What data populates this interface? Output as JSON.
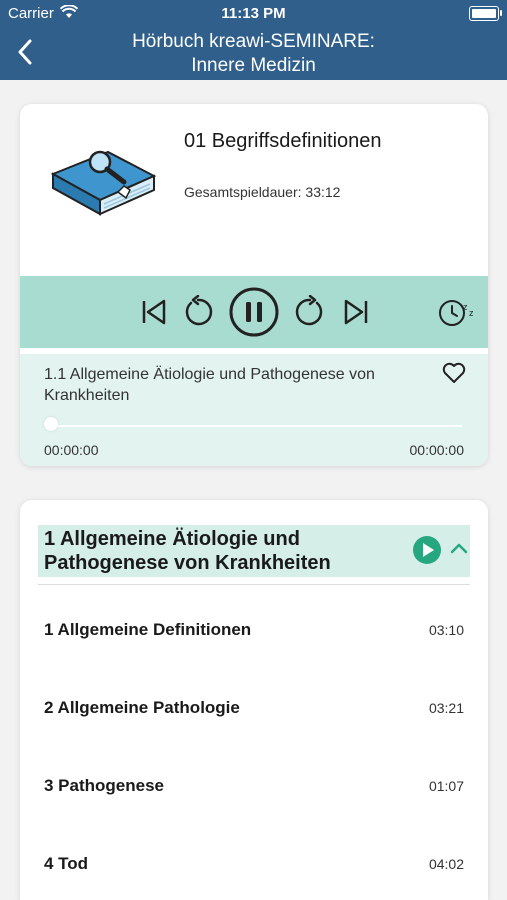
{
  "status_bar": {
    "carrier": "Carrier",
    "time": "11:13 PM"
  },
  "nav": {
    "title_line1": "Hörbuch kreawi-SEMINARE:",
    "title_line2": "Innere Medizin",
    "color": "#2f5f8a"
  },
  "player": {
    "track_title": "01 Begriffsdefinitionen",
    "duration_label": "Gesamtspieldauer:",
    "duration_value": "33:12",
    "current_chapter": "1.1 Allgemeine Ätiologie und Pathogenese von Krankheiten",
    "elapsed": "00:00:00",
    "remaining": "00:00:00",
    "progress": 0,
    "controls": [
      "skip-back-icon",
      "rewind-icon",
      "pause-icon",
      "forward-icon",
      "skip-forward-icon",
      "sleep-timer-icon"
    ],
    "accent": "#a9dcd1"
  },
  "section": {
    "title": "1 Allgemeine Ätiologie und Pathogenese von Krankheiten",
    "play_color": "#27a77f"
  },
  "chapters": [
    {
      "name": "1 Allgemeine Definitionen",
      "length": "03:10"
    },
    {
      "name": "2 Allgemeine Pathologie",
      "length": "03:21"
    },
    {
      "name": "3 Pathogenese",
      "length": "01:07"
    },
    {
      "name": "4 Tod",
      "length": "04:02"
    }
  ]
}
